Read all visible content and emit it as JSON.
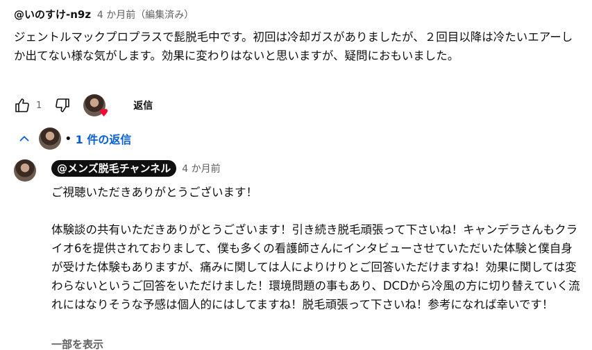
{
  "comment": {
    "author": "@いのすけ-n9z",
    "meta": "4 か月前（編集済み）",
    "text": "ジェントルマックプロプラスで髭脱毛中です。初回は冷却ガスがありましたが、２回目以降は冷たいエアーしか出てない様な気がします。効果に変わりはないと思いますが、疑問におもいました。",
    "like_count": "1",
    "reply_label": "返信"
  },
  "replies_toggle": {
    "label": "1 件の返信"
  },
  "reply": {
    "author": "@メンズ脱毛チャンネル",
    "time": "4 か月前",
    "line1": "ご視聴いただきありがとうございます！",
    "line2": "体験談の共有いただきありがとうございます！引き続き脱毛頑張って下さいね！キャンデラさんもクライオ6を提供されておりまして、僕も多くの看護師さんにインタビューさせていただいた体験と僕自身が受けた体験もありますが、痛みに関しては人によりけりとご回答いただけますね！効果に関しては変わらないというご回答をいただけました！環境問題の事もあり、DCDから冷風の方に切り替えていく流れにはなりそうな予感は個人的にはしてますね！脱毛頑張って下さいね！参考になれば幸いです！",
    "show_more": "一部を表示"
  },
  "colors": {
    "link": "#065fd4",
    "heart": "#ff0033",
    "pill_bg": "#0f0f0f"
  },
  "icons": [
    "thumb-up-icon",
    "thumb-down-icon",
    "heart-icon",
    "chevron-up-icon"
  ]
}
